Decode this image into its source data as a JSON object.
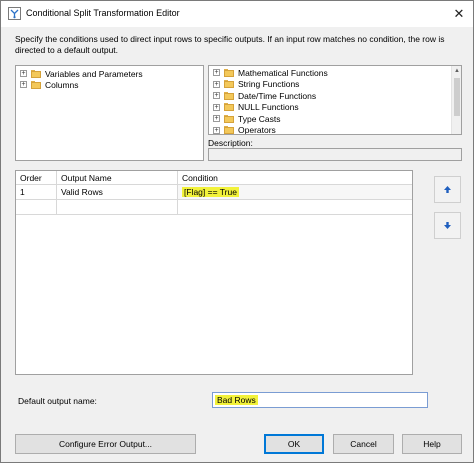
{
  "window": {
    "title": "Conditional Split Transformation Editor",
    "close_glyph": "✕"
  },
  "description": "Specify the conditions used to direct input rows to specific outputs. If an input row matches no condition, the row is directed to a default output.",
  "left_tree": {
    "items": [
      {
        "label": "Variables and Parameters",
        "expander": "+",
        "icon": "folder-icon"
      },
      {
        "label": "Columns",
        "expander": "+",
        "icon": "folder-icon"
      }
    ]
  },
  "right_tree": {
    "items": [
      {
        "label": "Mathematical Functions",
        "expander": "+",
        "icon": "folder-icon"
      },
      {
        "label": "String Functions",
        "expander": "+",
        "icon": "folder-icon"
      },
      {
        "label": "Date/Time Functions",
        "expander": "+",
        "icon": "folder-icon"
      },
      {
        "label": "NULL Functions",
        "expander": "+",
        "icon": "folder-icon"
      },
      {
        "label": "Type Casts",
        "expander": "+",
        "icon": "folder-icon"
      },
      {
        "label": "Operators",
        "expander": "+",
        "icon": "folder-icon"
      }
    ]
  },
  "description_label": "Description:",
  "grid": {
    "columns": [
      "Order",
      "Output Name",
      "Condition"
    ],
    "rows": [
      {
        "order": "1",
        "output_name": "Valid Rows",
        "condition": "[Flag] == True"
      }
    ]
  },
  "move_up_icon": "arrow-up-icon",
  "move_down_icon": "arrow-down-icon",
  "default_output_label": "Default output name:",
  "default_output_value": "Bad Rows",
  "buttons": {
    "configure": "Configure Error Output...",
    "ok": "OK",
    "cancel": "Cancel",
    "help": "Help"
  },
  "colors": {
    "highlight": "#f2f23a",
    "arrow_blue": "#1f5fbf"
  }
}
